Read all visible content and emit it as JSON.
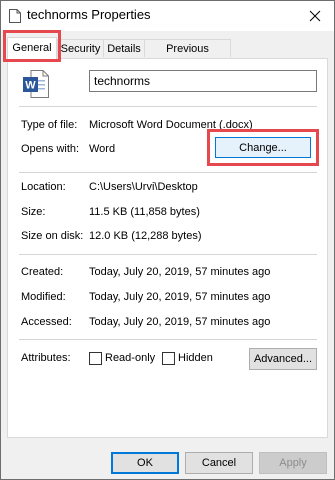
{
  "window": {
    "title": "technorms Properties"
  },
  "tabs": [
    {
      "label": "General",
      "active": true
    },
    {
      "label": "Security",
      "active": false
    },
    {
      "label": "Details",
      "active": false
    },
    {
      "label": "Previous Versions",
      "active": false
    }
  ],
  "file": {
    "name": "technorms",
    "icon": "word-document-icon"
  },
  "info": {
    "type_label": "Type of file:",
    "type_value": "Microsoft Word Document (.docx)",
    "opens_label": "Opens with:",
    "opens_value": "Word",
    "change_button": "Change...",
    "location_label": "Location:",
    "location_value": "C:\\Users\\Urvi\\Desktop",
    "size_label": "Size:",
    "size_value": "11.5 KB (11,858 bytes)",
    "size_disk_label": "Size on disk:",
    "size_disk_value": "12.0 KB (12,288 bytes)",
    "created_label": "Created:",
    "created_value": "Today, July 20, 2019, 57 minutes ago",
    "modified_label": "Modified:",
    "modified_value": "Today, July 20, 2019, 57 minutes ago",
    "accessed_label": "Accessed:",
    "accessed_value": "Today, July 20, 2019, 57 minutes ago",
    "attributes_label": "Attributes:",
    "readonly_label": "Read-only",
    "readonly_checked": false,
    "hidden_label": "Hidden",
    "hidden_checked": false,
    "advanced_button": "Advanced..."
  },
  "footer": {
    "ok": "OK",
    "cancel": "Cancel",
    "apply": "Apply"
  },
  "colors": {
    "highlight": "#e5484d",
    "word_blue": "#2b579a",
    "focus_blue": "#0078d7"
  }
}
